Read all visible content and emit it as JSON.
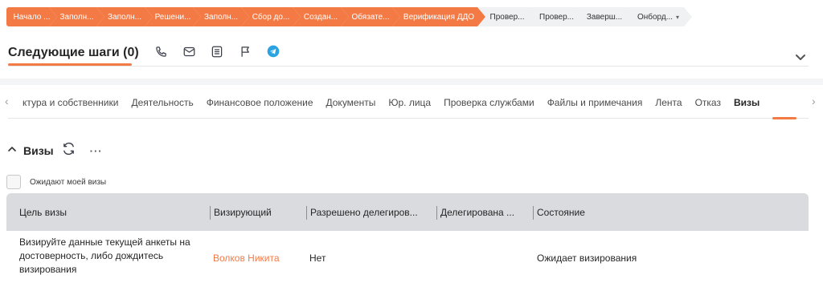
{
  "stages": [
    {
      "label": "Начало ...",
      "state": "done",
      "width": 63
    },
    {
      "label": "Заполн...",
      "state": "done",
      "width": 69
    },
    {
      "label": "Заполн...",
      "state": "done",
      "width": 70
    },
    {
      "label": "Решени...",
      "state": "done",
      "width": 70
    },
    {
      "label": "Заполн...",
      "state": "done",
      "width": 70
    },
    {
      "label": "Сбор до...",
      "state": "done",
      "width": 74
    },
    {
      "label": "Создан...",
      "state": "done",
      "width": 70
    },
    {
      "label": "Обязате...",
      "state": "done",
      "width": 74
    },
    {
      "label": "Верификация ДДО",
      "state": "done",
      "width": 116
    },
    {
      "label": "Провер...",
      "state": "todo",
      "width": 74
    },
    {
      "label": "Провер...",
      "state": "todo",
      "width": 69
    },
    {
      "label": "Заверш...",
      "state": "todo",
      "width": 70
    },
    {
      "label": "Онборд...",
      "state": "todo",
      "width": 84,
      "caret": "▾"
    }
  ],
  "colors": {
    "accent": "#f37a45",
    "stage_todo_bg": "#f0f1f3",
    "telegram": "#2aa3e0",
    "table_header_bg": "#d9dbdf"
  },
  "next_steps": {
    "title": "Следующие шаги (0)",
    "icons": [
      "phone-icon",
      "mail-icon",
      "note-icon",
      "flag-icon",
      "telegram-icon"
    ]
  },
  "tabs": {
    "items": [
      "ктура и собственники",
      "Деятельность",
      "Финансовое положение",
      "Документы",
      "Юр. лица",
      "Проверка службами",
      "Файлы и примечания",
      "Лента",
      "Отказ",
      "Визы"
    ],
    "active": "Визы",
    "left_arrow": "‹",
    "right_arrow": "›"
  },
  "visas": {
    "title": "Визы",
    "more": "···",
    "filter_label": "Ожидают моей визы",
    "columns": [
      "Цель визы",
      "Визирующий",
      "Разрешено делегиров...",
      "Делегирована ...",
      "Состояние"
    ],
    "rows": [
      {
        "goal": "Визируйте данные текущей анкеты на достоверность, либо дождитесь визирования",
        "signer": "Волков Никита",
        "delegation_allowed": "Нет",
        "delegated_to": "",
        "state": "Ожидает визирования"
      }
    ]
  }
}
